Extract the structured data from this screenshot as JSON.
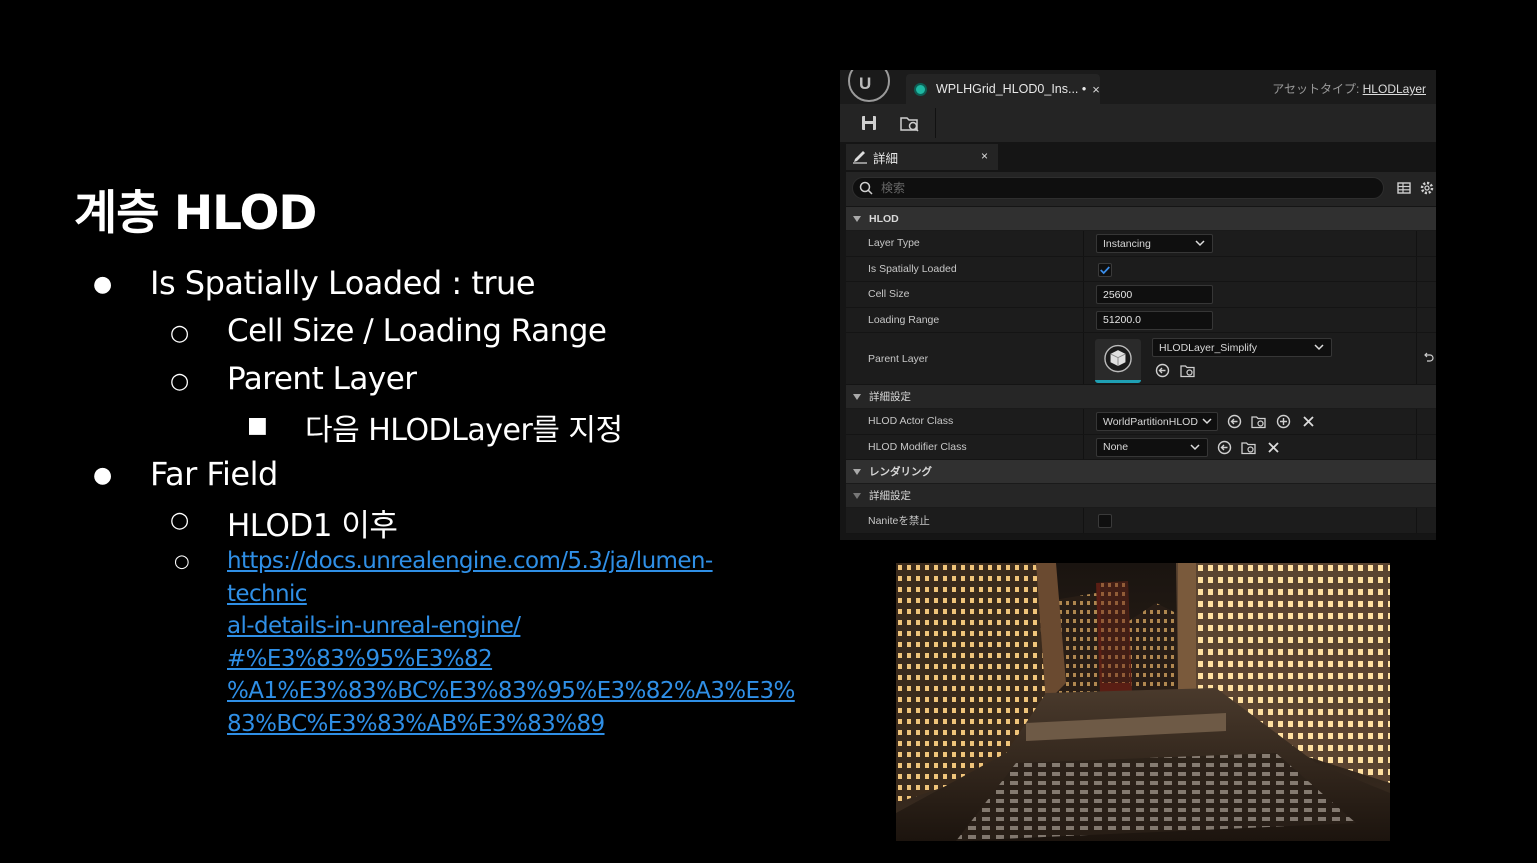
{
  "slide": {
    "title": "계층 HLOD",
    "bullets": [
      {
        "text": "Is Spatially Loaded : true",
        "children": [
          {
            "text": "Cell Size / Loading Range"
          },
          {
            "text": "Parent Layer",
            "children": [
              {
                "text": "다음 HLODLayer를 지정"
              }
            ]
          }
        ]
      },
      {
        "text": "Far Field",
        "children": [
          {
            "text": "HLOD1 이후"
          },
          {
            "text": "https://docs.unrealengine.com/5.3/ja/lumen-technical-details-in-unreal-engine/ #%E3%83%95%E3%82%A1%E3%83%BC%E3%83%95%E3%82%A3%E3%83%BC%E3%83%AB%E3%83%89"
          }
        ]
      }
    ],
    "link_lines": [
      "https://docs.unrealengine.com/5.3/ja/lumen-technic",
      "al-details-in-unreal-engine/ #%E3%83%95%E3%82",
      "%A1%E3%83%BC%E3%83%95%E3%82%A3%E3%",
      "83%BC%E3%83%AB%E3%83%89"
    ]
  },
  "editor": {
    "tab_label": "WPLHGrid_HLOD0_Ins... •",
    "tab_close": "×",
    "asset_type_prefix": "アセットタイプ: ",
    "asset_type_value": "HLODLayer",
    "details_tab_label": "詳細",
    "details_tab_close": "×",
    "search_placeholder": "検索",
    "categories": {
      "hlod": "HLOD",
      "advanced": "詳細設定",
      "rendering": "レンダリング",
      "rendering_advanced": "詳細設定"
    },
    "props": {
      "layer_type": {
        "label": "Layer Type",
        "value": "Instancing"
      },
      "spatially_loaded": {
        "label": "Is Spatially Loaded",
        "checked": true
      },
      "cell_size": {
        "label": "Cell Size",
        "value": "25600"
      },
      "loading_range": {
        "label": "Loading Range",
        "value": "51200.0"
      },
      "parent_layer": {
        "label": "Parent Layer",
        "value": "HLODLayer_Simplify"
      },
      "actor_class": {
        "label": "HLOD Actor Class",
        "value": "WorldPartitionHLOD"
      },
      "modifier_class": {
        "label": "HLOD Modifier Class",
        "value": "None"
      },
      "disallow_nanite": {
        "label": "Naniteを禁止",
        "checked": false
      }
    },
    "logo_text": "U"
  },
  "colors": {
    "background": "#000000",
    "link": "#2f8fe6",
    "editor_bg": "#151515",
    "checkbox_accent": "#1d6fd8",
    "asset_teal": "#1eb7a2"
  }
}
